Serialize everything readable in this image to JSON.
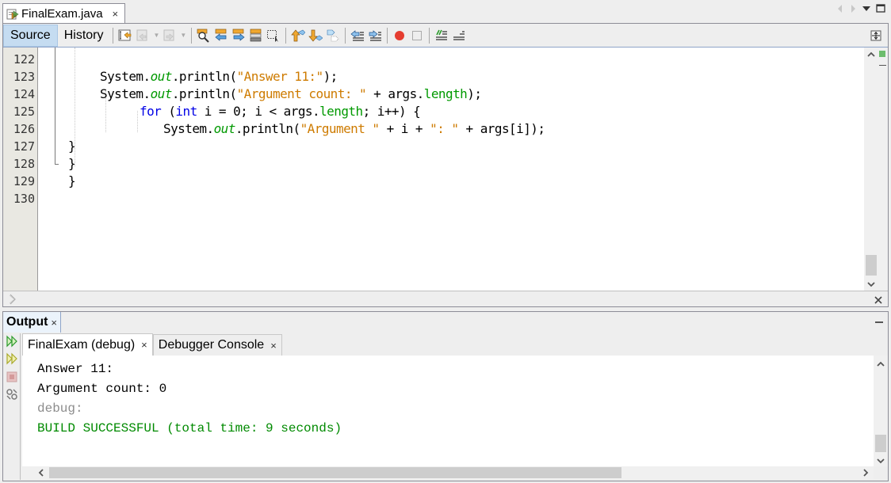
{
  "editor": {
    "file_tab": {
      "label": "FinalExam.java",
      "close": "×"
    },
    "modes": {
      "source": "Source",
      "history": "History"
    },
    "lines": [
      {
        "num": "122"
      },
      {
        "num": "123"
      },
      {
        "num": "124"
      },
      {
        "num": "125"
      },
      {
        "num": "126"
      },
      {
        "num": "127"
      },
      {
        "num": "128"
      },
      {
        "num": "129"
      },
      {
        "num": "130"
      }
    ],
    "code": {
      "l123": {
        "a": "System.",
        "b": "out",
        "c": ".println(",
        "d": "\"Answer 11:\"",
        "e": ");"
      },
      "l124": {
        "a": "System.",
        "b": "out",
        "c": ".println(",
        "d": "\"Argument count: \"",
        "e": " + args.",
        "f": "length",
        "g": ");"
      },
      "l125": {
        "kw1": "for",
        "a": " (",
        "kw2": "int",
        "b": " i = 0; i < args.",
        "f": "length",
        "c": "; i++) {"
      },
      "l126": {
        "a": "System.",
        "b": "out",
        "c": ".println(",
        "d": "\"Argument \"",
        "e": " + i + ",
        "f": "\": \"",
        "g": " + args[i]);"
      },
      "l127": "}",
      "l128": "}",
      "l129": "}"
    },
    "toolbar_icons": [
      "last-edit-icon",
      "back-icon",
      "forward-icon",
      "find-icon",
      "find-previous-icon",
      "find-next-icon",
      "toggle-highlight-icon",
      "toggle-rectangular-selection-icon",
      "previous-bookmark-icon",
      "next-bookmark-icon",
      "toggle-bookmark-icon",
      "shift-left-icon",
      "shift-right-icon",
      "start-macro-icon",
      "stop-macro-icon",
      "comment-icon",
      "uncomment-icon"
    ]
  },
  "output": {
    "tab_label": "Output",
    "tab_close": "×",
    "subtabs": [
      {
        "label": "FinalExam (debug)",
        "close": "×",
        "active": true
      },
      {
        "label": "Debugger Console",
        "close": "×",
        "active": false
      }
    ],
    "lines": [
      {
        "text": "Answer 11:",
        "color": "#000000"
      },
      {
        "text": "Argument count: 0",
        "color": "#000000"
      },
      {
        "text": "debug:",
        "color": "#8c8c8c"
      },
      {
        "text": "BUILD SUCCESSFUL (total time: 9 seconds)",
        "color": "#008a00"
      }
    ]
  },
  "colors": {
    "string": "#ce7b00",
    "field": "#009900",
    "keyword": "#0000e6",
    "build_success": "#008a00",
    "selected_mode": "#c5dcf1"
  }
}
